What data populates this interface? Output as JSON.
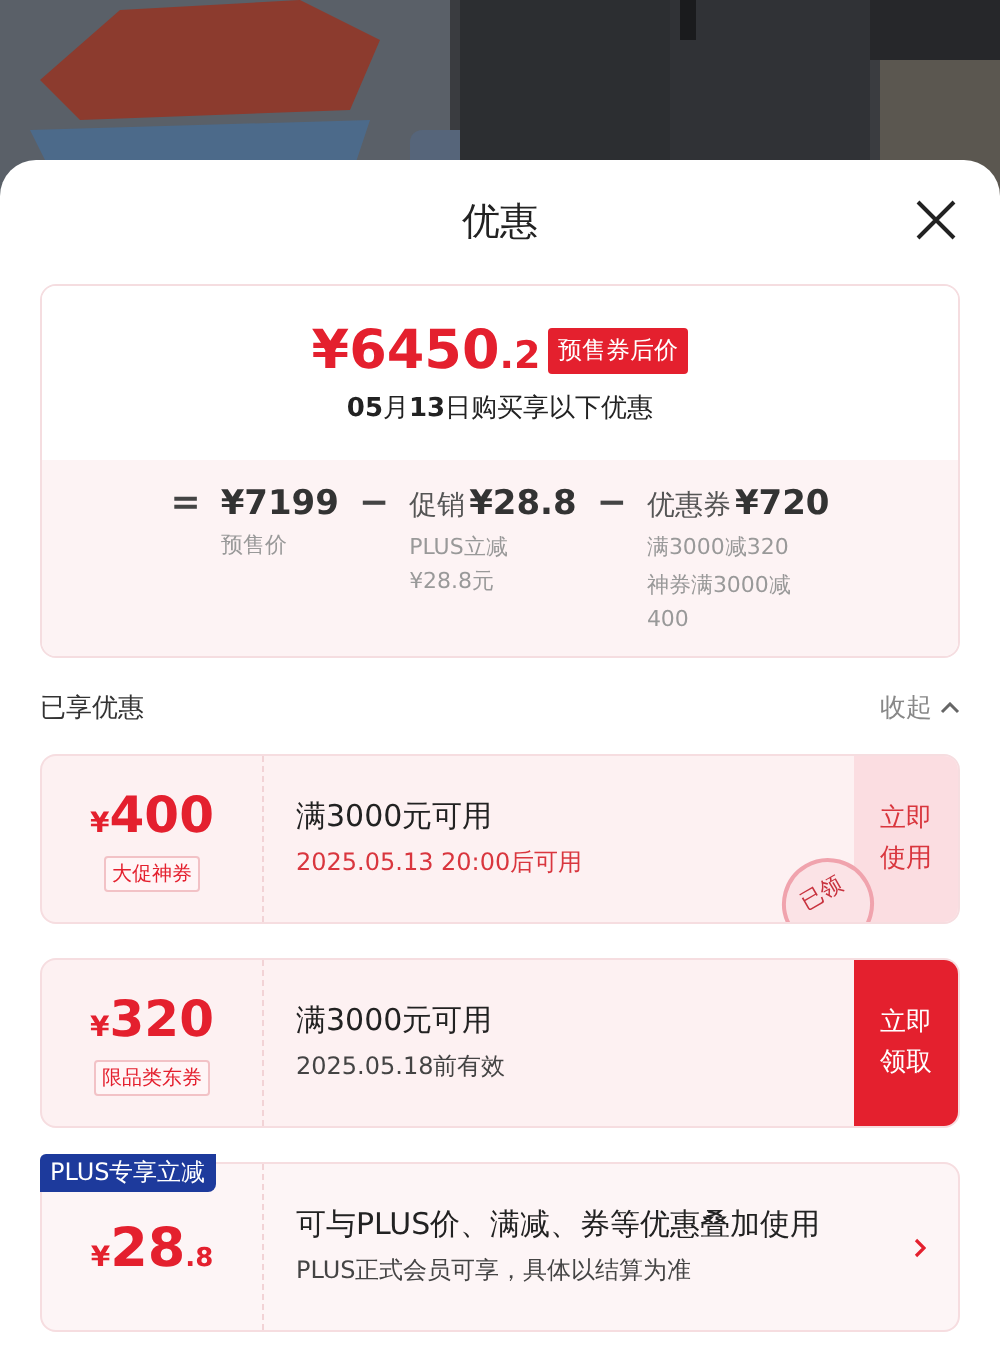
{
  "sheet": {
    "title": "优惠"
  },
  "summary": {
    "price": "¥6450",
    "price_decimal": ".2",
    "price_tag": "预售券后价",
    "subtitle": "**05**月**13**日购买享以下优惠",
    "terms": [
      {
        "operator": "=",
        "amount": "¥7199",
        "notes": [
          "预售价"
        ]
      },
      {
        "operator": "−",
        "label": "促销",
        "amount": "¥28.8",
        "notes": [
          "PLUS立减¥28.8元"
        ]
      },
      {
        "operator": "−",
        "label": "优惠券",
        "amount": "¥720",
        "notes": [
          "满3000减320",
          "神券满3000减400"
        ]
      }
    ]
  },
  "section": {
    "title": "已享优惠",
    "toggle": "收起",
    "expanded": true
  },
  "coupons": [
    {
      "kind": "coupon",
      "currency": "¥",
      "amount": "400",
      "tag": "大促神券",
      "condition": "满3000元可用",
      "validity": "2025.05.13 20:00后可用",
      "action": "立即使用",
      "claimed": true,
      "stamp": "已领"
    },
    {
      "kind": "coupon",
      "currency": "¥",
      "amount": "320",
      "tag": "限品类东券",
      "condition": "满3000元可用",
      "validity": "2025.05.18前有效",
      "action": "立即领取",
      "claimed": false
    },
    {
      "kind": "plus",
      "badge": "PLUS专享立减",
      "currency": "¥",
      "amount": "28",
      "decimal": ".8",
      "condition": "可与PLUS价、满减、券等优惠叠加使用",
      "validity": "PLUS正式会员可享，具体以结算为准"
    }
  ]
}
